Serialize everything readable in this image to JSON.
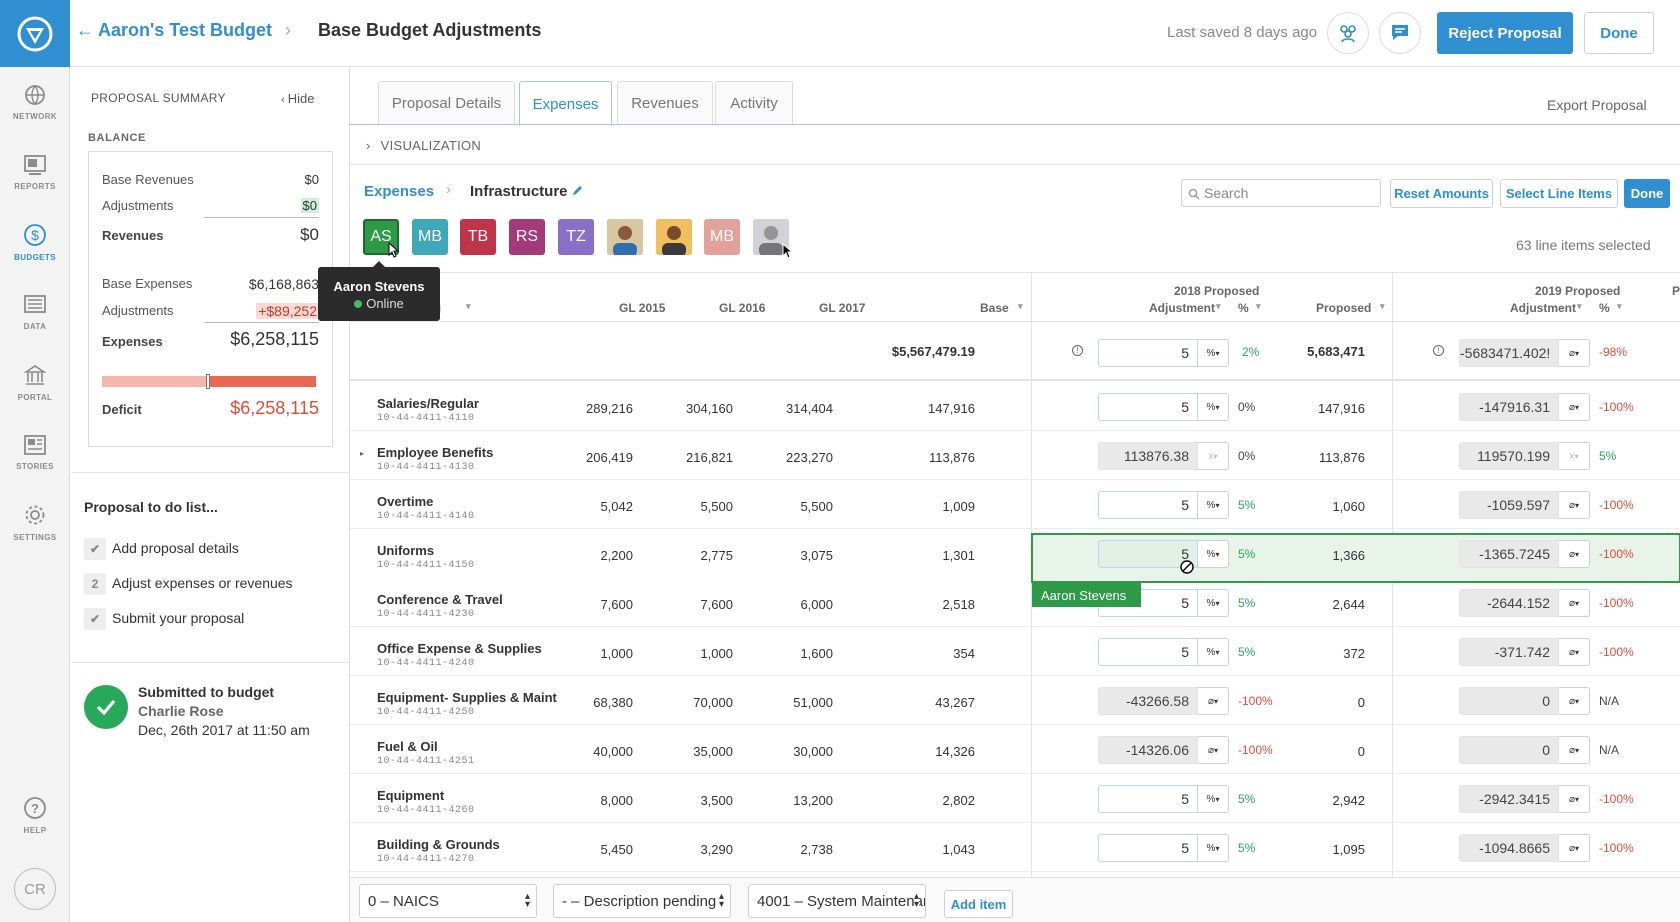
{
  "header": {
    "back_icon": "arrow-left-icon",
    "budget_name": "Aaron's Test Budget",
    "separator": "›",
    "page_title": "Base Budget Adjustments",
    "last_saved": "Last saved 8 days ago",
    "reject_label": "Reject Proposal",
    "done_label": "Done"
  },
  "rail": {
    "items": [
      {
        "label": "NETWORK",
        "icon": "globe-icon"
      },
      {
        "label": "REPORTS",
        "icon": "reports-icon"
      },
      {
        "label": "BUDGETS",
        "icon": "dollar-icon"
      },
      {
        "label": "DATA",
        "icon": "data-icon"
      },
      {
        "label": "PORTAL",
        "icon": "building-icon"
      },
      {
        "label": "STORIES",
        "icon": "stories-icon"
      },
      {
        "label": "SETTINGS",
        "icon": "gear-icon"
      },
      {
        "label": "HELP",
        "icon": "help-icon"
      }
    ],
    "user_initials": "CR",
    "accent": "#2f8fd0"
  },
  "summary": {
    "title": "PROPOSAL SUMMARY",
    "hide_label": "Hide",
    "balance_title": "BALANCE",
    "base_revenues_label": "Base Revenues",
    "base_revenues": "$0",
    "adj_rev_label": "Adjustments",
    "adj_rev": "$0",
    "revenues_label": "Revenues",
    "revenues": "$0",
    "base_expenses_label": "Base Expenses",
    "base_expenses": "$6,168,863",
    "adj_exp_label": "Adjustments",
    "adj_exp": "+$89,252",
    "expenses_label": "Expenses",
    "expenses": "$6,258,115",
    "deficit_label": "Deficit",
    "deficit": "$6,258,115",
    "todo_title": "Proposal to do list...",
    "todos": [
      {
        "label": "Add proposal details",
        "mark": "✔"
      },
      {
        "label": "Adjust expenses or revenues",
        "mark": "2"
      },
      {
        "label": "Submit your proposal",
        "mark": "✔"
      }
    ],
    "submitted_title": "Submitted to budget",
    "submitted_by": "Charlie Rose",
    "submitted_at": "Dec, 26th 2017 at 11:50 am"
  },
  "tabs": [
    "Proposal Details",
    "Expenses",
    "Revenues",
    "Activity"
  ],
  "export_label": "Export Proposal",
  "visualization_label": "VISUALIZATION",
  "breadcrumb": {
    "root": "Expenses",
    "current": "Infrastructure"
  },
  "toolbar": {
    "search_placeholder": "Search",
    "reset_label": "Reset Amounts",
    "select_label": "Select Line Items",
    "done_label": "Done",
    "selected_count": "63 line items selected"
  },
  "collaborators": [
    {
      "initials": "AS",
      "color": "#2e9a48"
    },
    {
      "initials": "MB",
      "color": "#3fa8b8"
    },
    {
      "initials": "TB",
      "color": "#c0344a"
    },
    {
      "initials": "RS",
      "color": "#a33a7a"
    },
    {
      "initials": "TZ",
      "color": "#8a6fc8"
    },
    {
      "initials": "",
      "color": "#6b8aa8"
    },
    {
      "initials": "",
      "color": "#b88a3a"
    },
    {
      "initials": "MB",
      "color": "#e3a19b"
    },
    {
      "initials": "",
      "color": "#9a9aa0"
    }
  ],
  "tooltip": {
    "name": "Aaron Stevens",
    "status": "Online"
  },
  "table": {
    "headers": {
      "account": "ing",
      "gl2015": "GL 2015",
      "gl2016": "GL 2016",
      "gl2017": "GL 2017",
      "base": "Base",
      "p2018": "2018 Proposed",
      "p2019": "2019 Proposed",
      "adjustment": "Adjustment",
      "pct": "%",
      "proposed": "Proposed",
      "sort": "▾"
    },
    "totals": {
      "base": "$5,567,479.19",
      "adj18": "5",
      "unit18": "%",
      "pct18": "2%",
      "prop18": "5,683,471",
      "adj19": "-5683471.402!",
      "unit19": "⌀",
      "pct19": "-98%"
    },
    "rows": [
      {
        "name": "Salaries/Regular",
        "code": "10-44-4411-4110",
        "gl15": "289,216",
        "gl16": "304,160",
        "gl17": "314,404",
        "base": "147,916",
        "adj18": "5",
        "unit18": "%",
        "pct18": "0%",
        "prop18": "147,916",
        "adj19": "-147916.31",
        "unit19": "⌀",
        "pct19": "-100%"
      },
      {
        "name": "Employee Benefits",
        "code": "10-44-4411-4130",
        "gl15": "206,419",
        "gl16": "216,821",
        "gl17": "223,270",
        "base": "113,876",
        "adj18": "113876.38",
        "unit18": "x",
        "pct18": "0%",
        "prop18": "113,876",
        "adj19": "119570.199",
        "unit19": "x",
        "pct19": "5%"
      },
      {
        "name": "Overtime",
        "code": "10-44-4411-4140",
        "gl15": "5,042",
        "gl16": "5,500",
        "gl17": "5,500",
        "base": "1,009",
        "adj18": "5",
        "unit18": "%",
        "pct18": "5%",
        "prop18": "1,060",
        "adj19": "-1059.597",
        "unit19": "⌀",
        "pct19": "-100%"
      },
      {
        "name": "Uniforms",
        "code": "10-44-4411-4150",
        "gl15": "2,200",
        "gl16": "2,775",
        "gl17": "3,075",
        "base": "1,301",
        "adj18": "5",
        "unit18": "%",
        "pct18": "5%",
        "prop18": "1,366",
        "adj19": "-1365.7245",
        "unit19": "⌀",
        "pct19": "-100%"
      },
      {
        "name": "Conference & Travel",
        "code": "10-44-4411-4230",
        "gl15": "7,600",
        "gl16": "7,600",
        "gl17": "6,000",
        "base": "2,518",
        "adj18": "5",
        "unit18": "%",
        "pct18": "5%",
        "prop18": "2,644",
        "adj19": "-2644.152",
        "unit19": "⌀",
        "pct19": "-100%"
      },
      {
        "name": "Office Expense & Supplies",
        "code": "10-44-4411-4240",
        "gl15": "1,000",
        "gl16": "1,000",
        "gl17": "1,600",
        "base": "354",
        "adj18": "5",
        "unit18": "%",
        "pct18": "5%",
        "prop18": "372",
        "adj19": "-371.742",
        "unit19": "⌀",
        "pct19": "-100%"
      },
      {
        "name": "Equipment- Supplies & Maint",
        "code": "10-44-4411-4250",
        "gl15": "68,380",
        "gl16": "70,000",
        "gl17": "51,000",
        "base": "43,267",
        "adj18": "-43266.58",
        "unit18": "⌀",
        "pct18": "-100%",
        "prop18": "0",
        "adj19": "0",
        "unit19": "⌀",
        "pct19": "N/A"
      },
      {
        "name": "Fuel & Oil",
        "code": "10-44-4411-4251",
        "gl15": "40,000",
        "gl16": "35,000",
        "gl17": "30,000",
        "base": "14,326",
        "adj18": "-14326.06",
        "unit18": "⌀",
        "pct18": "-100%",
        "prop18": "0",
        "adj19": "0",
        "unit19": "⌀",
        "pct19": "N/A"
      },
      {
        "name": "Equipment",
        "code": "10-44-4411-4260",
        "gl15": "8,000",
        "gl16": "3,500",
        "gl17": "13,200",
        "base": "2,802",
        "adj18": "5",
        "unit18": "%",
        "pct18": "5%",
        "prop18": "2,942",
        "adj19": "-2942.3415",
        "unit19": "⌀",
        "pct19": "-100%"
      },
      {
        "name": "Building & Grounds",
        "code": "10-44-4411-4270",
        "gl15": "5,450",
        "gl16": "3,290",
        "gl17": "2,738",
        "base": "1,043",
        "adj18": "5",
        "unit18": "%",
        "pct18": "5%",
        "prop18": "1,095",
        "adj19": "-1094.8665",
        "unit19": "⌀",
        "pct19": "-100%"
      }
    ],
    "highlight_user": "Aaron Stevens"
  },
  "footer": {
    "naics": "0 – NAICS",
    "description": "- – Description pending",
    "system": "4001 – System Maintenance",
    "add_label": "Add item"
  }
}
